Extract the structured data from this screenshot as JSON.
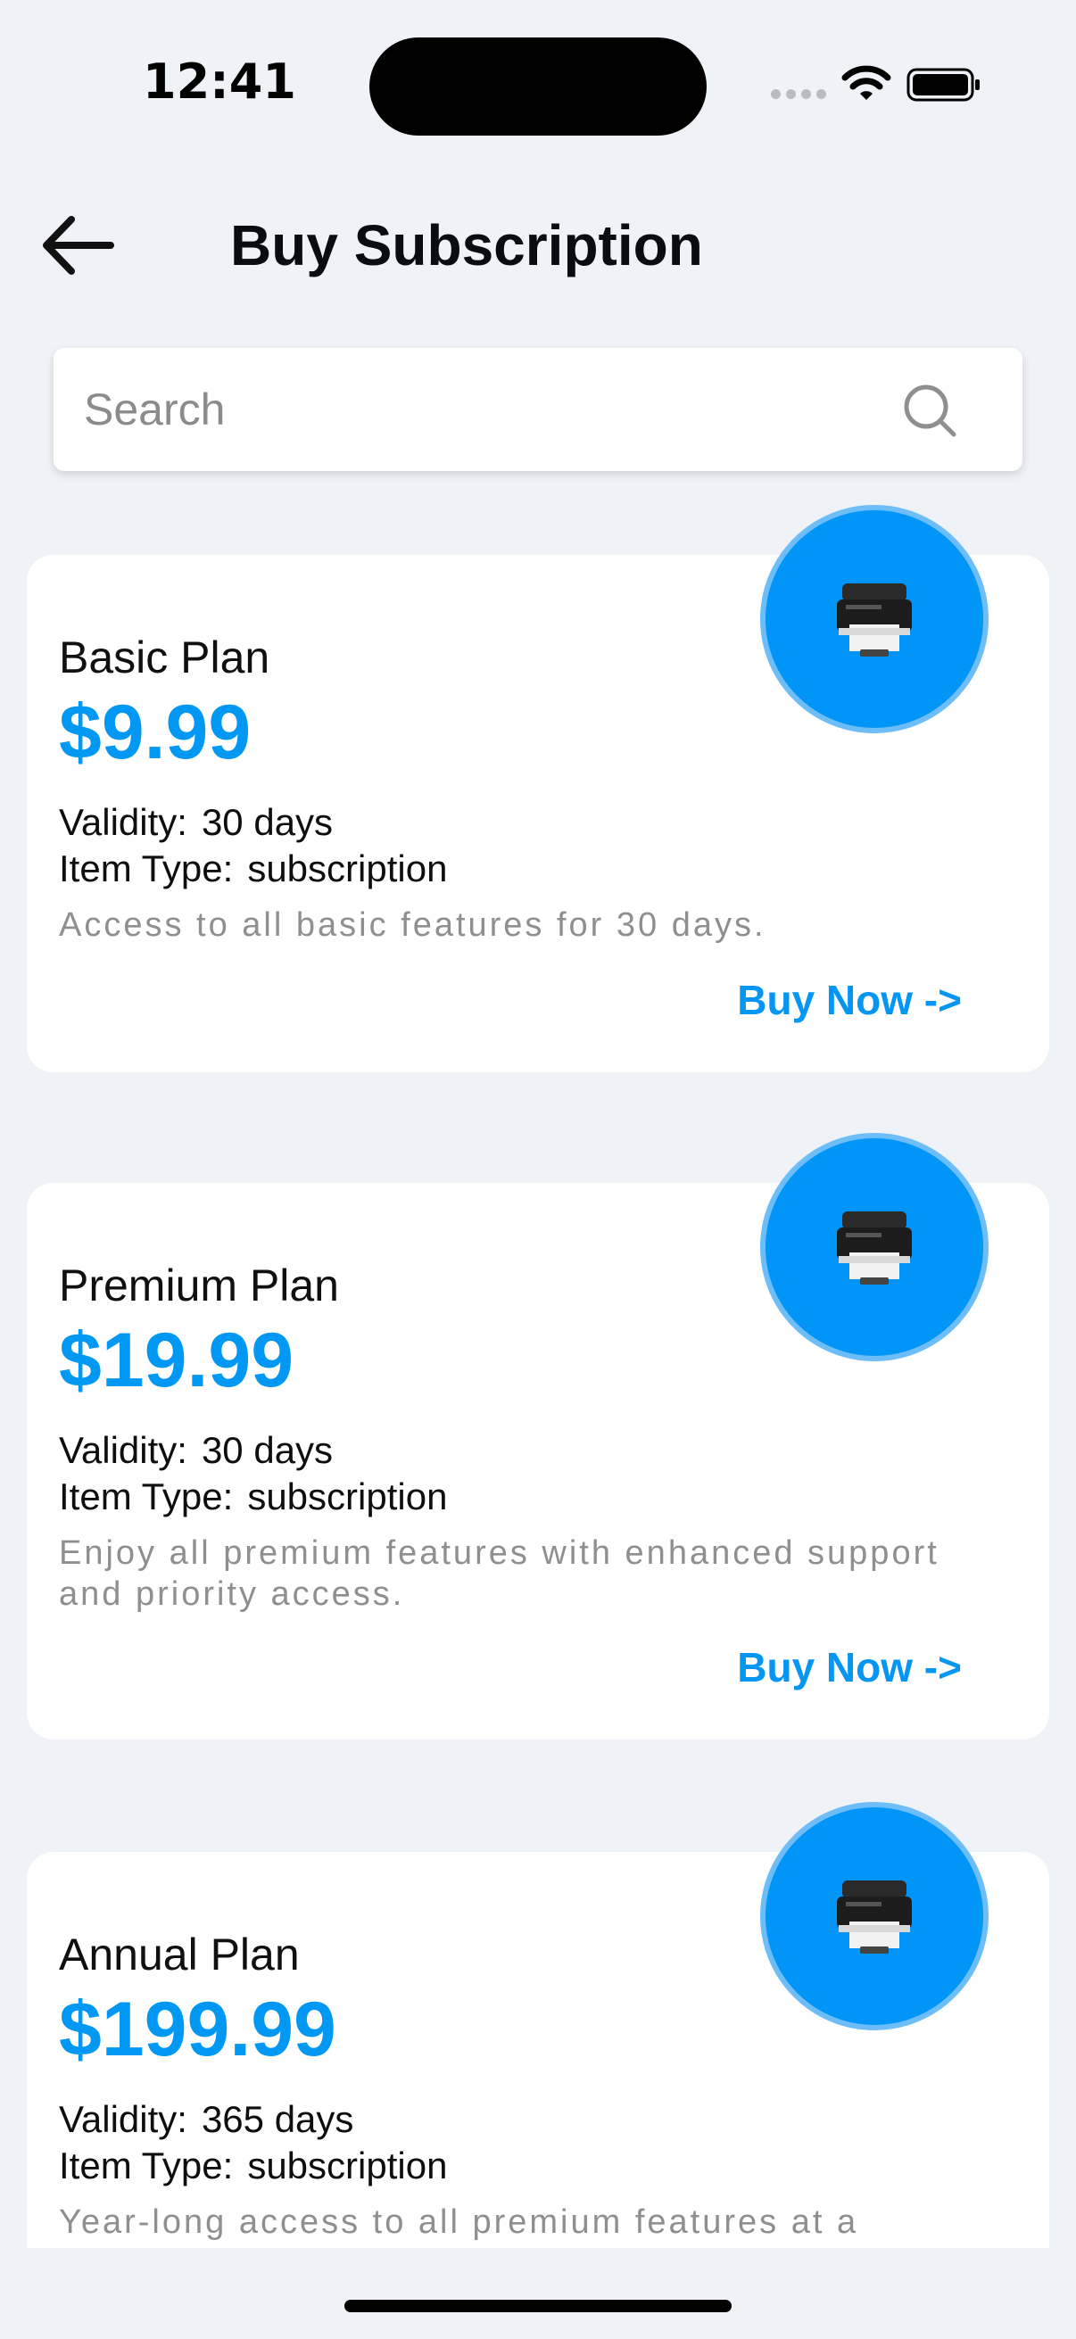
{
  "status_bar": {
    "time": "12:41"
  },
  "header": {
    "title": "Buy Subscription",
    "back_icon": "arrow-left-icon"
  },
  "search": {
    "placeholder": "Search",
    "value": "",
    "icon": "search-icon"
  },
  "plans": [
    {
      "name": "Basic Plan",
      "price": "$9.99",
      "validity_label": "Validity:",
      "validity": "30 days",
      "type_label": "Item Type:",
      "type": "subscription",
      "description": "Access to all basic features for 30 days.",
      "buy_label": "Buy Now ->",
      "icon": "printer-icon"
    },
    {
      "name": "Premium Plan",
      "price": "$19.99",
      "validity_label": "Validity:",
      "validity": "30 days",
      "type_label": "Item Type:",
      "type": "subscription",
      "description": "Enjoy all premium features with enhanced support and priority access.",
      "buy_label": "Buy Now ->",
      "icon": "printer-icon"
    },
    {
      "name": "Annual Plan",
      "price": "$199.99",
      "validity_label": "Validity:",
      "validity": "365 days",
      "type_label": "Item Type:",
      "type": "subscription",
      "description": "Year-long access to all premium features at a",
      "buy_label": "",
      "icon": "printer-icon"
    }
  ],
  "colors": {
    "accent": "#0098f3",
    "background": "#eff2f7",
    "badge": "#0095f6"
  }
}
